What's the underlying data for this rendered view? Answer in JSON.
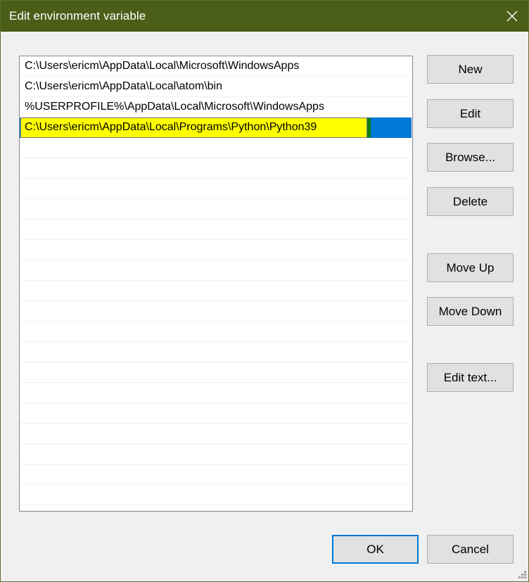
{
  "window": {
    "title": "Edit environment variable",
    "close_icon": "close-icon"
  },
  "colors": {
    "titlebar": "#4b5e18",
    "selection": "#0078d7",
    "highlight": "#ffff00",
    "default_button_border": "#0078d7"
  },
  "list": {
    "items": [
      "C:\\Users\\ericm\\AppData\\Local\\Microsoft\\WindowsApps",
      "C:\\Users\\ericm\\AppData\\Local\\atom\\bin",
      "%USERPROFILE%\\AppData\\Local\\Microsoft\\WindowsApps",
      "C:\\Users\\ericm\\AppData\\Local\\Programs\\Python\\Python39"
    ],
    "selected_index": 3,
    "editing_value": "C:\\Users\\ericm\\AppData\\Local\\Programs\\Python\\Python39"
  },
  "buttons": {
    "new": "New",
    "edit": "Edit",
    "browse": "Browse...",
    "delete": "Delete",
    "move_up": "Move Up",
    "move_down": "Move Down",
    "edit_text": "Edit text...",
    "ok": "OK",
    "cancel": "Cancel"
  }
}
